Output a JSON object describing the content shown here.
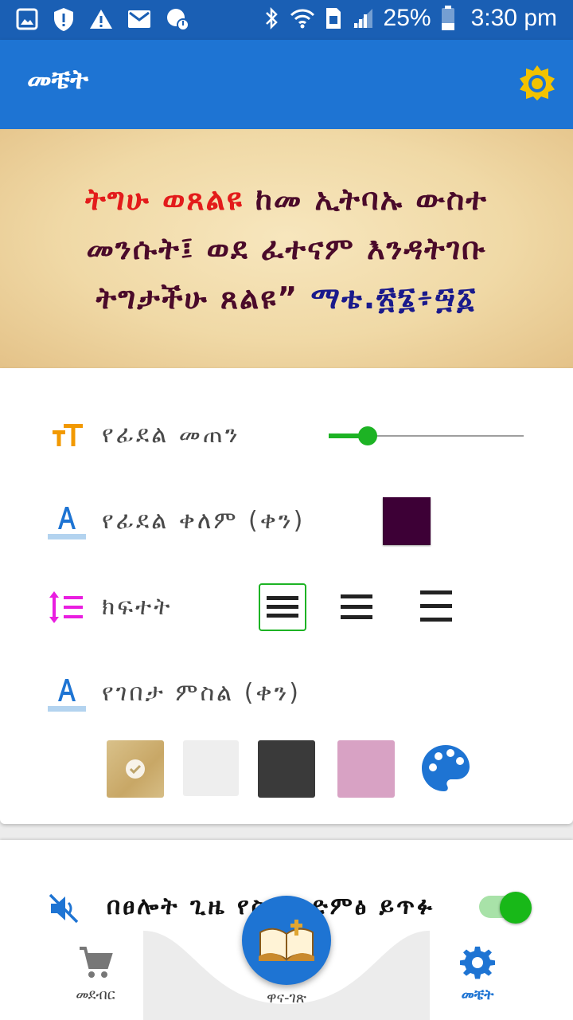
{
  "status_bar": {
    "battery": "25%",
    "time": "3:30 pm",
    "left_icons": [
      "gallery-icon",
      "shield-alert-icon",
      "warning-icon",
      "email-icon",
      "sync-alert-icon"
    ],
    "right_icons": [
      "bluetooth-icon",
      "wifi-icon",
      "sim-icon",
      "signal-icon",
      "battery-icon"
    ]
  },
  "app_bar": {
    "title": "መቼት",
    "action_icon": "brightness-icon"
  },
  "verse": {
    "highlight": "ትግሁ ወጸልዩ",
    "body": " ከመ ኢትባኡ ውስተ መንሱት፤ ወደ ፈተናም እንዳትገቡ ትግታችሁ ጸልዩ” ",
    "reference": "ማቴ.፳፮፥፵፩"
  },
  "settings": {
    "font_size": {
      "label": "የፊደል መጠን",
      "level": 0.2
    },
    "font_color": {
      "label": "የፊደል ቀለም (ቀን)",
      "value_color": "#3d0036"
    },
    "line_spacing": {
      "label": "ክፍተት",
      "options": [
        "compact",
        "normal",
        "wide"
      ],
      "selected": 0
    },
    "background": {
      "label": "የገበታ ምስል (ቀን)",
      "options": [
        "parchment",
        "#eeeeee",
        "#3a3a3a",
        "#d8a2c4",
        "custom-palette"
      ],
      "selected": 0
    }
  },
  "silent_mode": {
    "label": "በፀሎት ጊዜ የስልክ ድምፅ ይጥፉ",
    "enabled": true
  },
  "bottom_nav": {
    "items": [
      {
        "label": "መደብር",
        "icon": "cart-icon",
        "active": false
      },
      {
        "label": "ዋና-ገጽ",
        "icon": "bible-icon",
        "active": false
      },
      {
        "label": "መቼት",
        "icon": "gear-icon",
        "active": true
      }
    ]
  },
  "colors": {
    "primary": "#1e74d3",
    "status_bar": "#1a5fb4",
    "accent_green": "#1db324",
    "verse_text": "#4a0a2a",
    "verse_highlight": "#e31b1b",
    "icon_orange": "#f29900",
    "icon_magenta": "#e91ee0"
  }
}
